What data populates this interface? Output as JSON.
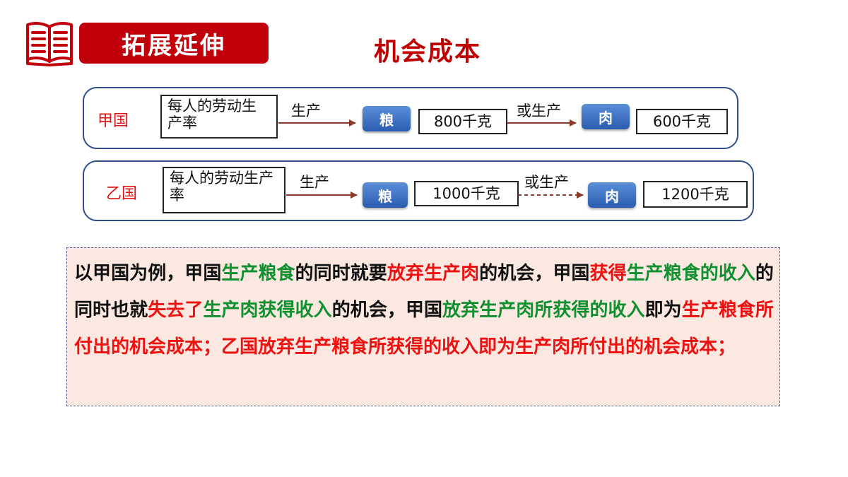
{
  "header": {
    "badge_text": "拓展延伸",
    "title": "机会成本"
  },
  "colors": {
    "accent_red": "#c0000b",
    "panel_border": "#2f4f8f",
    "pill_blue": "#3a6fc4",
    "arrow": "#8b3a2a",
    "text_green": "#109030",
    "text_red": "#ee1111"
  },
  "diagram": {
    "rows": [
      {
        "country": "甲国",
        "rate_label": "每人的劳动生产率",
        "produce_label": "生产",
        "item1": "粮",
        "qty1": "800千克",
        "or_label": "或生产",
        "item2": "肉",
        "qty2": "600千克"
      },
      {
        "country": "乙国",
        "rate_label": "每人的劳动生产率",
        "produce_label": "生产",
        "item1": "粮",
        "qty1": "1000千克",
        "or_label": "或生产",
        "item2": "肉",
        "qty2": "1200千克"
      }
    ]
  },
  "explanation": {
    "segments": [
      {
        "text": "以甲国为例，甲国",
        "color": "black"
      },
      {
        "text": "生产粮食",
        "color": "green"
      },
      {
        "text": "的同时就要",
        "color": "black"
      },
      {
        "text": "放弃",
        "color": "red"
      },
      {
        "text": "生产肉",
        "color": "red"
      },
      {
        "text": "的机会，甲国",
        "color": "black"
      },
      {
        "text": "获得",
        "color": "red"
      },
      {
        "text": "生产粮食的收入",
        "color": "green"
      },
      {
        "text": "的同时也就",
        "color": "black"
      },
      {
        "text": "失去了",
        "color": "red"
      },
      {
        "text": "生产肉获得收入",
        "color": "green"
      },
      {
        "text": "的机会，甲国",
        "color": "black"
      },
      {
        "text": "放弃生产肉所获得的收入",
        "color": "green"
      },
      {
        "text": "即为",
        "color": "black"
      },
      {
        "text": "生产粮食所付出的机会成本；乙国放弃生产粮食所获得的收入即为生产肉所付出的机会成本；",
        "color": "red"
      }
    ]
  }
}
